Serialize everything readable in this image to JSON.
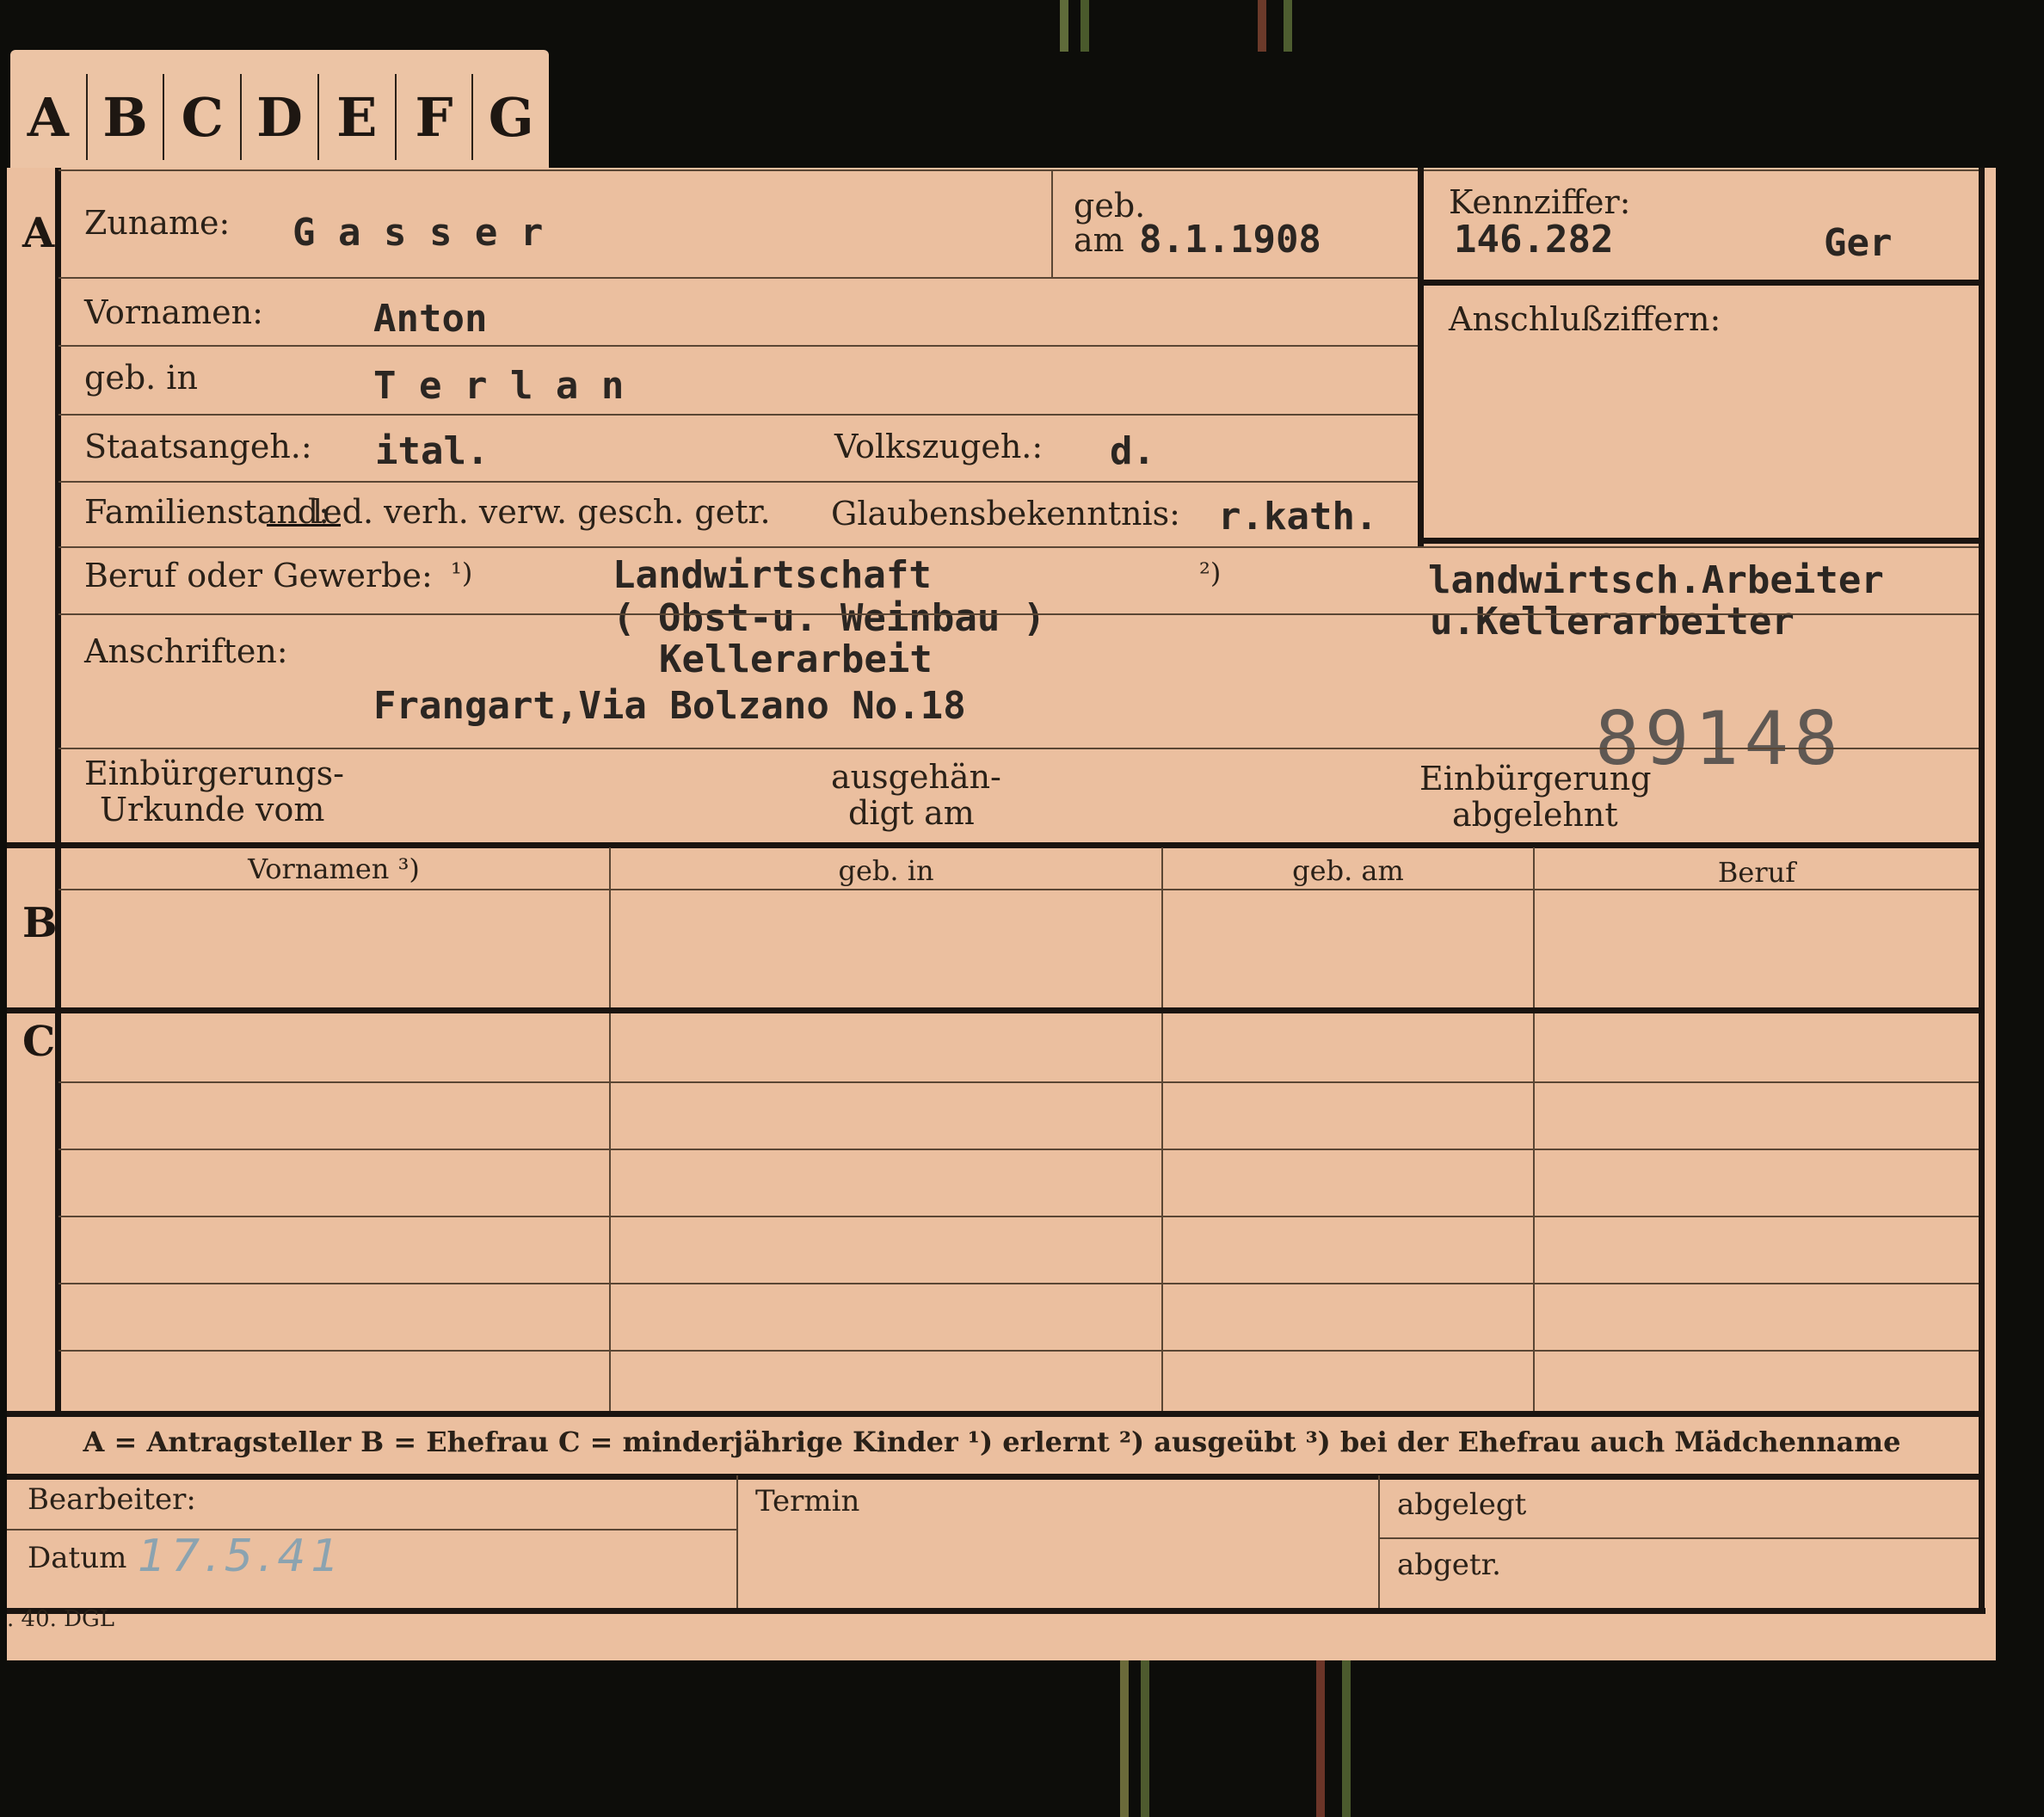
{
  "tabs": [
    "A",
    "B",
    "C",
    "D",
    "E",
    "F",
    "G"
  ],
  "sections": {
    "a": "A",
    "b": "B",
    "c": "C"
  },
  "fields": {
    "zuname_label": "Zuname:",
    "zuname_value": "G a s s e r",
    "geb_label_1": "geb.",
    "geb_label_2": "am",
    "geb_value": "8.1.1908",
    "kennziffer_label": "Kennziffer:",
    "kennziffer_value": "146.282",
    "kennziffer_suffix": "Ger",
    "anschluss_label": "Anschlußziffern:",
    "vornamen_label": "Vornamen:",
    "vornamen_value": "Anton",
    "gebin_label": "geb. in",
    "gebin_value": "T e r l a n",
    "staats_label": "Staatsangeh.:",
    "staats_value": "ital.",
    "volks_label": "Volkszugeh.:",
    "volks_value": "d.",
    "familie_label": "Familienstand:",
    "familie_options": "led. verh. verw. gesch. getr.",
    "glauben_label": "Glaubensbekenntnis:",
    "glauben_value": "r.kath.",
    "beruf_label": "Beruf oder Gewerbe:",
    "beruf_note1": "¹)",
    "beruf_value1_line1": "Landwirtschaft",
    "beruf_value1_line2": "( Obst-u. Weinbau )",
    "beruf_value1_line3": "Kellerarbeit",
    "beruf_note2": "²)",
    "beruf_value2_line1": "landwirtsch.Arbeiter",
    "beruf_value2_line2": "u.Kellerarbeiter",
    "anschriften_label": "Anschriften:",
    "anschriften_value": "Frangart,Via Bolzano No.18",
    "stamp_number": "89148",
    "einb_urkunde_1": "Einbürgerungs-",
    "einb_urkunde_2": "Urkunde vom",
    "ausgehaendigt_1": "ausgehän-",
    "ausgehaendigt_2": "digt am",
    "einb_abgelehnt_1": "Einbürgerung",
    "einb_abgelehnt_2": "abgelehnt"
  },
  "table_headers": [
    "Vornamen ³)",
    "geb. in",
    "geb. am",
    "Beruf"
  ],
  "legend": "A = Antragsteller   B = Ehefrau   C = minderjährige Kinder   ¹) erlernt   ²) ausgeübt   ³) bei der Ehefrau auch Mädchenname",
  "footer": {
    "bearbeiter_label": "Bearbeiter:",
    "datum_label": "Datum",
    "datum_value": "17.5.41",
    "termin_label": "Termin",
    "abgelegt_label": "abgelegt",
    "abgetr_label": "abgetr.",
    "print_code": ". 40. DGL"
  }
}
